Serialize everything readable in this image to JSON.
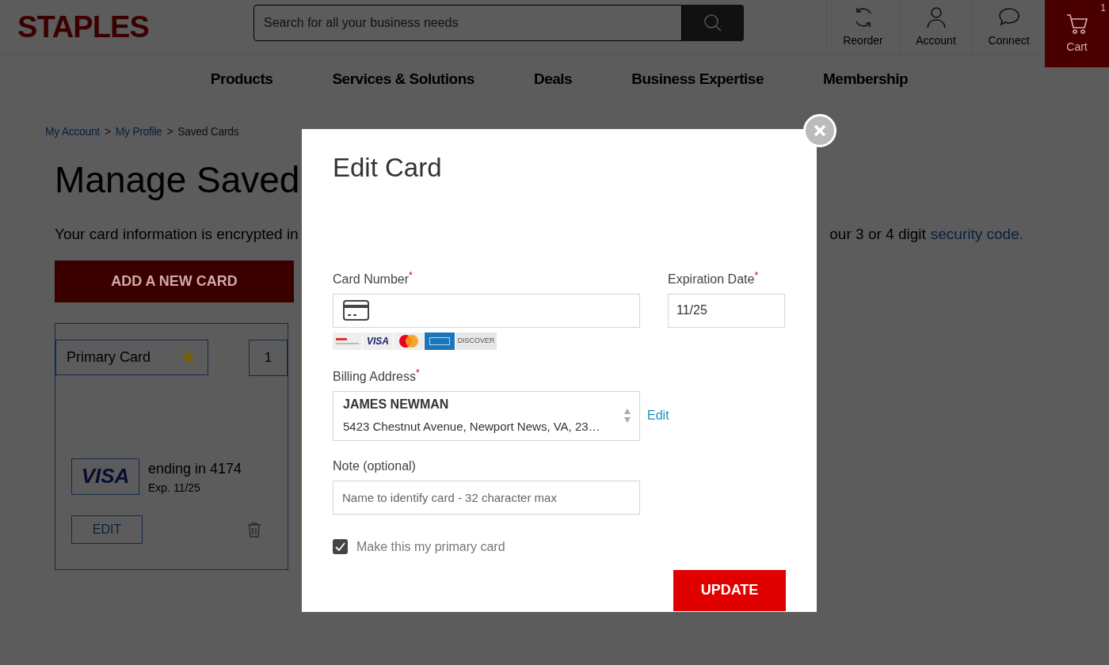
{
  "header": {
    "logo": "STAPLES",
    "search": {
      "placeholder": "Search for all your business needs"
    },
    "links": [
      {
        "label": "Reorder",
        "kind": "reorder"
      },
      {
        "label": "Account",
        "kind": "account"
      },
      {
        "label": "Connect",
        "kind": "connect"
      }
    ],
    "cart": {
      "label": "Cart",
      "count": "1"
    }
  },
  "nav": [
    "Products",
    "Services & Solutions",
    "Deals",
    "Business Expertise",
    "Membership"
  ],
  "breadcrumb": [
    {
      "kind": "link",
      "text": "My Account"
    },
    {
      "kind": "separator",
      "text": ">"
    },
    {
      "kind": "link",
      "text": "My Profile"
    },
    {
      "kind": "separator",
      "text": ">"
    },
    {
      "kind": "current",
      "text": "Saved Cards"
    }
  ],
  "page_title": "Manage Saved",
  "intro": {
    "left": "Your card information is encrypted in",
    "right": "our 3 or 4 digit",
    "link": "security code."
  },
  "add_button": "ADD A NEW CARD",
  "saved_card": {
    "primary_label": "Primary Card",
    "primary": true,
    "page_number": "1",
    "brand": "VISA",
    "ending": "ending in 4174",
    "expiry": "Exp. 11/25",
    "edit_button": "EDIT"
  },
  "modal": {
    "title": "Edit Card",
    "card_number": {
      "label": "Card Number$^{*}$"
    },
    "card_brands": [
      {
        "kind": "generic"
      },
      {
        "kind": "visa",
        "label": "VISA"
      },
      {
        "kind": "mastercard"
      },
      {
        "kind": "amex"
      },
      {
        "kind": "discover",
        "label": "DISCOVER"
      }
    ],
    "expiration": {
      "label": "Expiration Date$^{*}$",
      "value": "11/25"
    },
    "billing": {
      "label": "Billing Address$^{*}$",
      "name": "JAMES NEWMAN",
      "address": "5423 Chestnut Avenue, Newport News, VA, 23…",
      "edit_link": "Edit"
    },
    "note": {
      "label": "Note (optional)",
      "placeholder": "Name to identify card - 32 character max"
    },
    "primary_checkbox": {
      "label": "Make this my primary card",
      "checked": true
    },
    "update_button": "UPDATE"
  }
}
